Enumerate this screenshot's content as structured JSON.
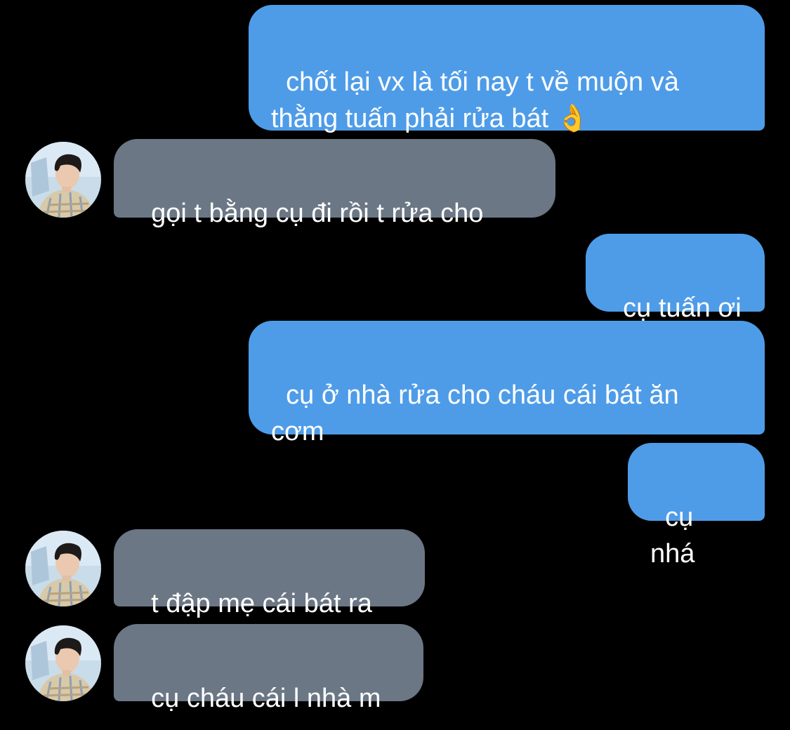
{
  "colors": {
    "background": "#000000",
    "sent_bubble": "#4e9ce8",
    "received_bubble": "#6b7785",
    "text": "#ffffff"
  },
  "messages": [
    {
      "direction": "sent",
      "text": "chốt lại vx là tối nay t về muộn và thằng tuấn phải rửa bát 👌"
    },
    {
      "direction": "received",
      "text": "gọi t bằng cụ đi rồi t rửa cho"
    },
    {
      "direction": "sent",
      "text": "cụ tuấn ơi"
    },
    {
      "direction": "sent",
      "text": "cụ ở nhà rửa cho cháu cái bát ăn cơm"
    },
    {
      "direction": "sent",
      "text": "cụ nhá"
    },
    {
      "direction": "received",
      "text": "t đập mẹ cái bát ra"
    },
    {
      "direction": "received",
      "text": "cụ cháu cái l nhà m"
    }
  ],
  "avatar_icon": "contact-photo"
}
